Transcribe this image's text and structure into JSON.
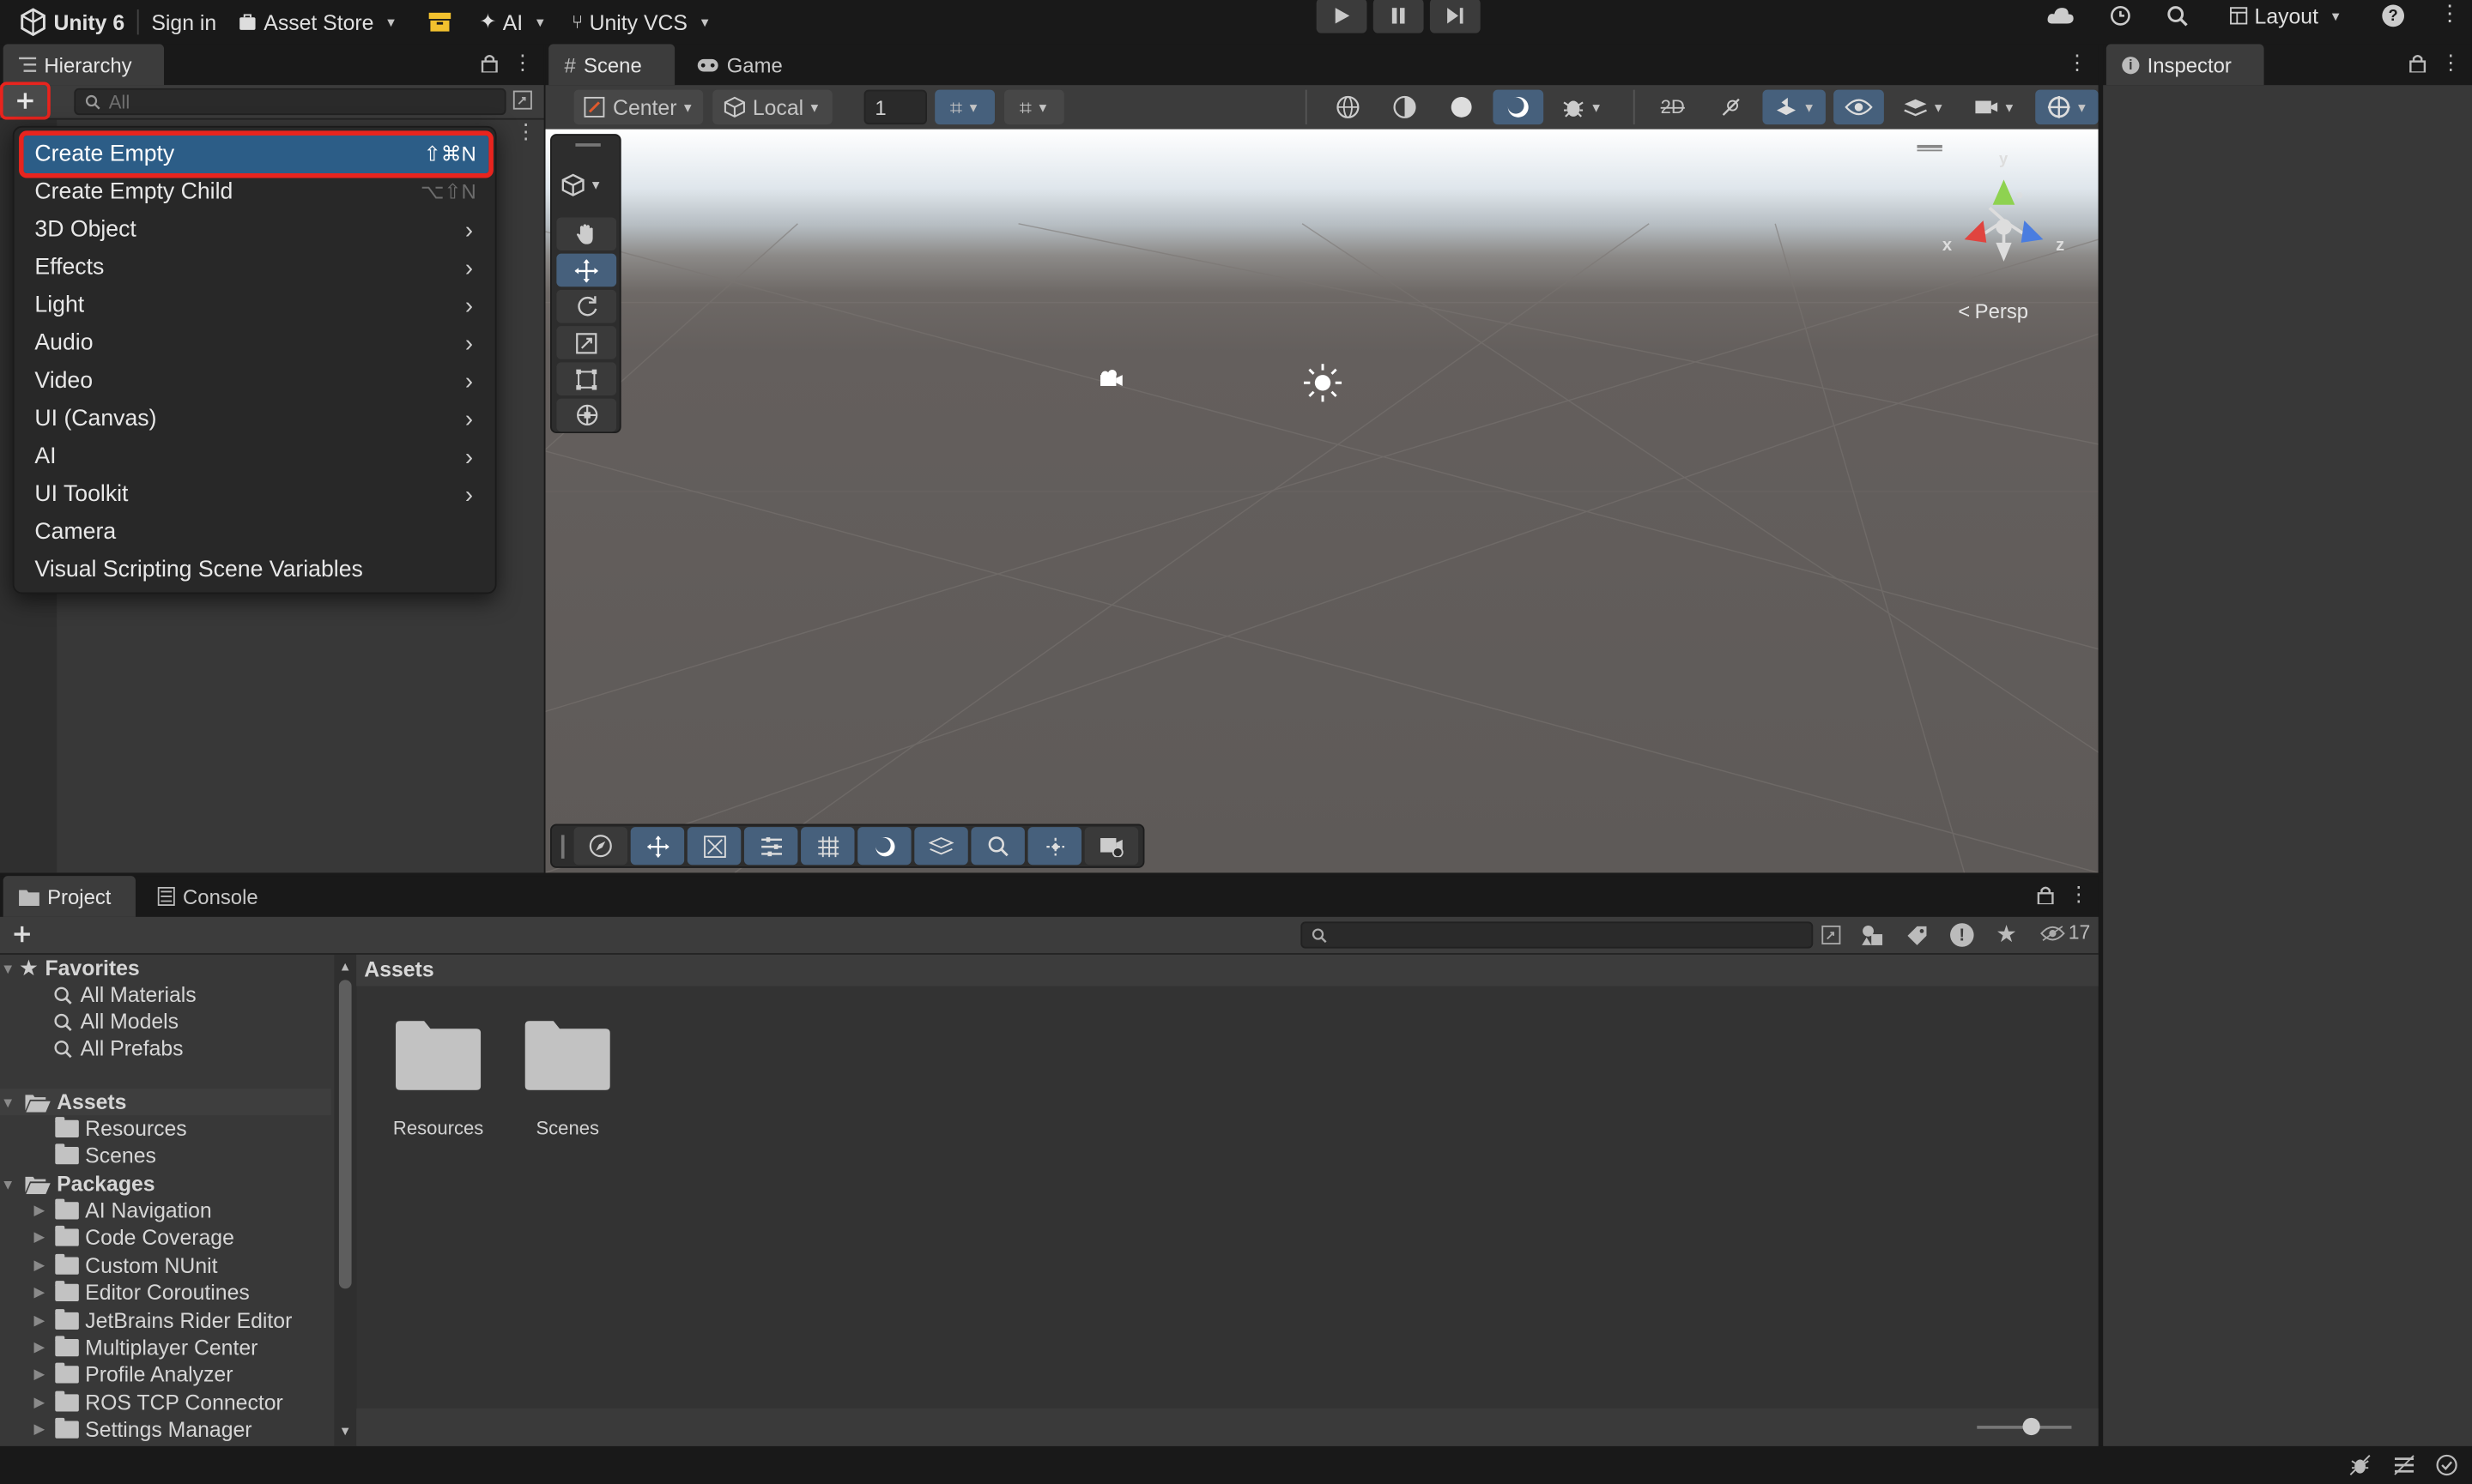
{
  "topbar": {
    "app_title": "Unity 6",
    "sign_in": "Sign in",
    "asset_store": "Asset Store",
    "ai": "AI",
    "vcs": "Unity VCS",
    "layout": "Layout"
  },
  "hierarchy": {
    "tab": "Hierarchy",
    "search_placeholder": "All"
  },
  "create_menu": {
    "items": [
      {
        "label": "Create Empty",
        "shortcut": "⇧⌘N",
        "submenu": false,
        "selected": true
      },
      {
        "label": "Create Empty Child",
        "shortcut": "⌥⇧N",
        "submenu": false
      },
      {
        "label": "3D Object",
        "submenu": true
      },
      {
        "label": "Effects",
        "submenu": true
      },
      {
        "label": "Light",
        "submenu": true
      },
      {
        "label": "Audio",
        "submenu": true
      },
      {
        "label": "Video",
        "submenu": true
      },
      {
        "label": "UI (Canvas)",
        "submenu": true
      },
      {
        "label": "AI",
        "submenu": true
      },
      {
        "label": "UI Toolkit",
        "submenu": true
      },
      {
        "label": "Camera",
        "submenu": false
      },
      {
        "label": "Visual Scripting Scene Variables",
        "submenu": false
      }
    ]
  },
  "scene": {
    "tab_scene": "Scene",
    "tab_game": "Game",
    "pivot": "Center",
    "space": "Local",
    "snap_value": "1",
    "projection": "Persp",
    "axis_x": "x",
    "axis_y": "y",
    "axis_z": "z"
  },
  "inspector": {
    "tab": "Inspector"
  },
  "project": {
    "tab_project": "Project",
    "tab_console": "Console",
    "breadcrumb": "Assets",
    "hidden_count": "17",
    "favorites": {
      "label": "Favorites",
      "items": [
        "All Materials",
        "All Models",
        "All Prefabs"
      ]
    },
    "assets": {
      "label": "Assets",
      "items": [
        "Resources",
        "Scenes"
      ]
    },
    "packages": {
      "label": "Packages",
      "items": [
        "AI Navigation",
        "Code Coverage",
        "Custom NUnit",
        "Editor Coroutines",
        "JetBrains Rider Editor",
        "Multiplayer Center",
        "Profile Analyzer",
        "ROS TCP Connector",
        "Settings Manager"
      ]
    },
    "grid_items": [
      "Resources",
      "Scenes"
    ]
  },
  "colors": {
    "selection": "#2c5d87",
    "highlight_box": "#e8241e",
    "active_tool": "#46607c"
  }
}
